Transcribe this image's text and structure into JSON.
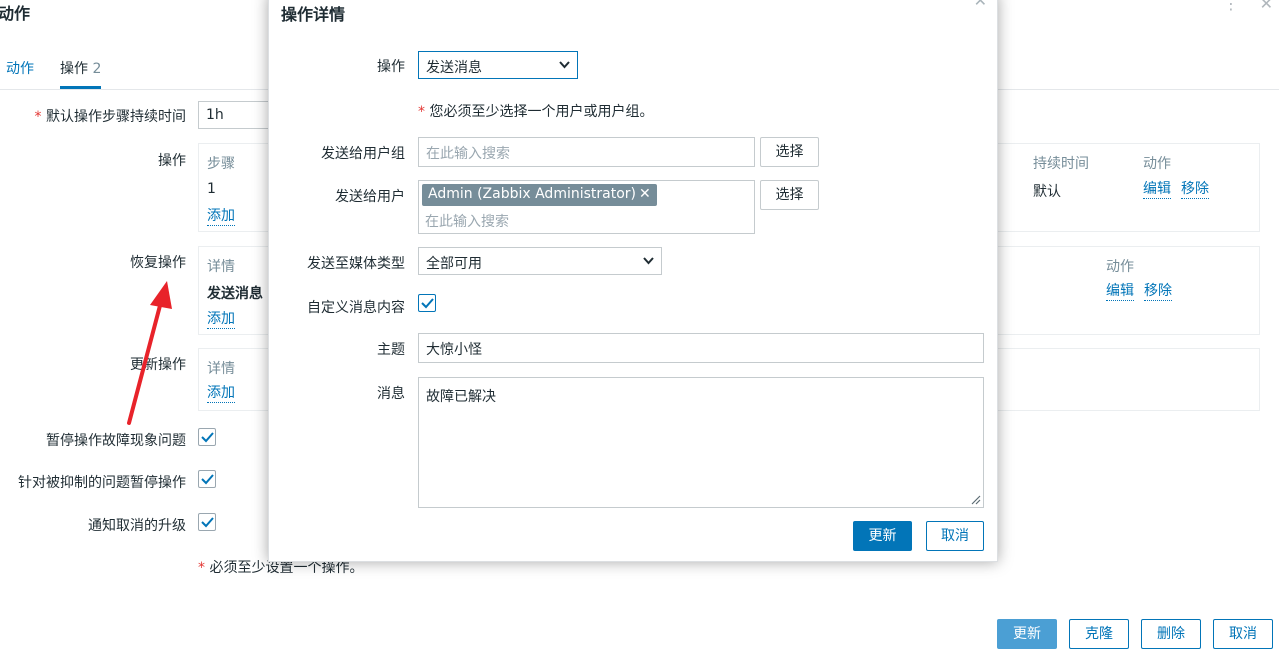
{
  "background": {
    "title": "动作",
    "tabs": [
      {
        "label": "动作"
      },
      {
        "label": "操作",
        "count": "2"
      }
    ],
    "fields": {
      "default_step_label": "默认操作步骤持续时间",
      "default_step_value": "1h",
      "operations_label": "操作",
      "recovery_label": "恢复操作",
      "update_label": "更新操作",
      "pause_symptoms_label": "暂停操作故障现象问题",
      "pause_suppressed_label": "针对被抑制的问题暂停操作",
      "notify_cancel_label": "通知取消的升级"
    },
    "operations_table": {
      "headers": {
        "steps": "步骤",
        "duration": "持续时间",
        "action": "动作"
      },
      "row": {
        "step": "1",
        "duration": "默认",
        "edit": "编辑",
        "remove": "移除"
      },
      "add": "添加"
    },
    "recovery_table": {
      "headers": {
        "details": "详情",
        "action": "动作"
      },
      "row": {
        "details": "发送消息",
        "edit": "编辑",
        "remove": "移除"
      },
      "add": "添加"
    },
    "update_table": {
      "headers": {
        "details": "详情"
      },
      "add": "添加"
    },
    "checkboxes": {
      "pause_symptoms": true,
      "pause_suppressed": true,
      "notify_cancel": true
    },
    "footnote": "必须至少设置一个操作。",
    "buttons": {
      "update": "更新",
      "clone": "克隆",
      "delete": "删除",
      "cancel": "取消"
    }
  },
  "modal": {
    "title": "操作详情",
    "operation_label": "操作",
    "operation_value": "发送消息",
    "requirement_note": "您必须至少选择一个用户或用户组。",
    "send_to_groups_label": "发送给用户组",
    "send_to_groups_placeholder": "在此输入搜索",
    "send_to_users_label": "发送给用户",
    "selected_user": "Admin (Zabbix Administrator)",
    "send_to_users_placeholder": "在此输入搜索",
    "select_button": "选择",
    "media_type_label": "发送至媒体类型",
    "media_type_value": "全部可用",
    "custom_message_label": "自定义消息内容",
    "custom_message_checked": true,
    "subject_label": "主题",
    "subject_value": "大惊小怪",
    "message_label": "消息",
    "message_value": "故障已解决",
    "buttons": {
      "update": "更新",
      "cancel": "取消"
    }
  },
  "colors": {
    "accent": "#0275b8",
    "required": "#e33734",
    "arrow": "#e8232a",
    "tag": "#768d99"
  }
}
